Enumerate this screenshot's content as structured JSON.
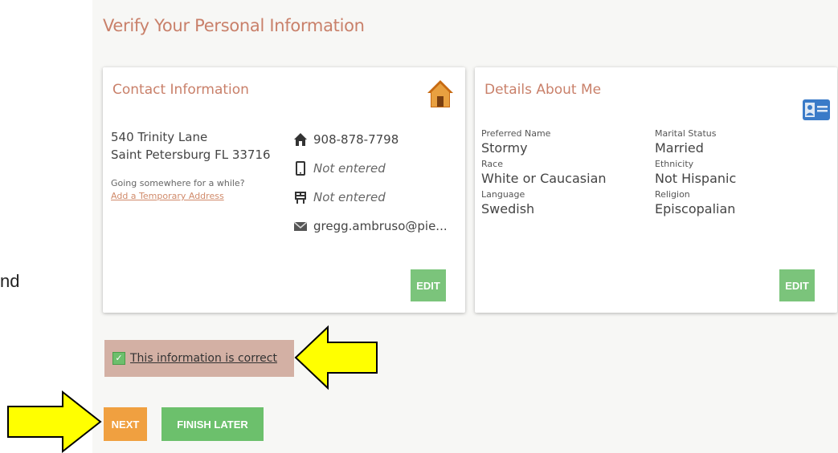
{
  "side_text": "nd",
  "page_title": "Verify Your Personal Information",
  "contact": {
    "title": "Contact Information",
    "address_line1": "540 Trinity Lane",
    "address_line2": "Saint Petersburg FL 33716",
    "temp_question": "Going somewhere for a while?",
    "temp_link": "Add a Temporary Address",
    "phone": "908-878-7798",
    "mobile": "Not entered",
    "fax": "Not entered",
    "email": "gregg.ambruso@pie...",
    "edit_label": "EDIT"
  },
  "details": {
    "title": "Details About Me",
    "fields": [
      {
        "label": "Preferred Name",
        "value": "Stormy"
      },
      {
        "label": "Marital Status",
        "value": "Married"
      },
      {
        "label": "Race",
        "value": "White or Caucasian"
      },
      {
        "label": "Ethnicity",
        "value": "Not Hispanic"
      },
      {
        "label": "Language",
        "value": "Swedish"
      },
      {
        "label": "Religion",
        "value": "Episcopalian"
      }
    ],
    "edit_label": "EDIT"
  },
  "confirm_label": "This information is correct",
  "buttons": {
    "next": "NEXT",
    "finish_later": "FINISH LATER"
  },
  "icons": {
    "home": "home-icon",
    "id_card": "id-card-icon",
    "phone": "phone-icon",
    "mobile": "mobile-icon",
    "fax": "fax-icon",
    "email": "email-icon",
    "check": "checkmark-icon",
    "arrow": "yellow-arrow-annotation"
  },
  "colors": {
    "accent_title": "#c9806a",
    "edit_green": "#7bc47b",
    "next_orange": "#f0a040",
    "finish_green": "#6cc06c",
    "confirm_bg": "#d3b0a4",
    "arrow_yellow": "#ffff00"
  }
}
